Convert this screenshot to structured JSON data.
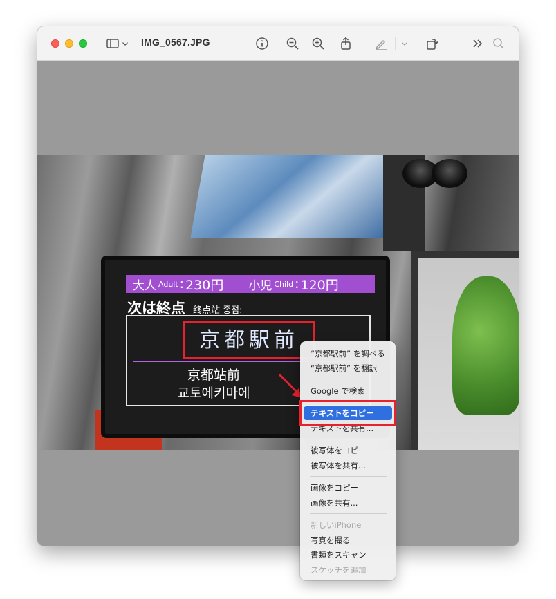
{
  "window": {
    "title": "IMG_0567.JPG"
  },
  "toolbar": {
    "icons": [
      "sidebar-icon",
      "chevron-down-icon",
      "info-icon",
      "zoom-out-icon",
      "zoom-in-icon",
      "share-icon",
      "markup-icon",
      "chevron-down-icon",
      "rotate-icon",
      "more-icon",
      "search-icon"
    ]
  },
  "photo": {
    "fare_adult_ja": "大人",
    "fare_adult_en": "Adult",
    "fare_adult_price": "230円",
    "fare_child_ja": "小児",
    "fare_child_en": "Child",
    "fare_child_price": "120円",
    "next_label": "次は終点",
    "terminal_label": "终点站 종점:",
    "destination": "京都駅前",
    "destination_cn": "京都站前",
    "destination_kr": "교토에키마에"
  },
  "context_menu": {
    "items": [
      {
        "label": "“京都駅前” を調べる",
        "disabled": false,
        "selected": false
      },
      {
        "label": "“京都駅前” を翻訳",
        "disabled": false,
        "selected": false
      },
      {
        "label": "Google で検索",
        "disabled": false,
        "selected": false
      },
      {
        "label": "テキストをコピー",
        "disabled": false,
        "selected": true
      },
      {
        "label": "テキストを共有...",
        "disabled": false,
        "selected": false
      },
      {
        "label": "被写体をコピー",
        "disabled": false,
        "selected": false
      },
      {
        "label": "被写体を共有...",
        "disabled": false,
        "selected": false
      },
      {
        "label": "画像をコピー",
        "disabled": false,
        "selected": false
      },
      {
        "label": "画像を共有...",
        "disabled": false,
        "selected": false
      },
      {
        "label": "新しいiPhone",
        "disabled": true,
        "selected": false
      },
      {
        "label": "写真を撮る",
        "disabled": false,
        "selected": false
      },
      {
        "label": "書類をスキャン",
        "disabled": false,
        "selected": false
      },
      {
        "label": "スケッチを追加",
        "disabled": true,
        "selected": false
      }
    ]
  },
  "colors": {
    "highlight": "#e8212f",
    "selection": "#2f6fe0",
    "fare_bar": "#a14fd0"
  }
}
